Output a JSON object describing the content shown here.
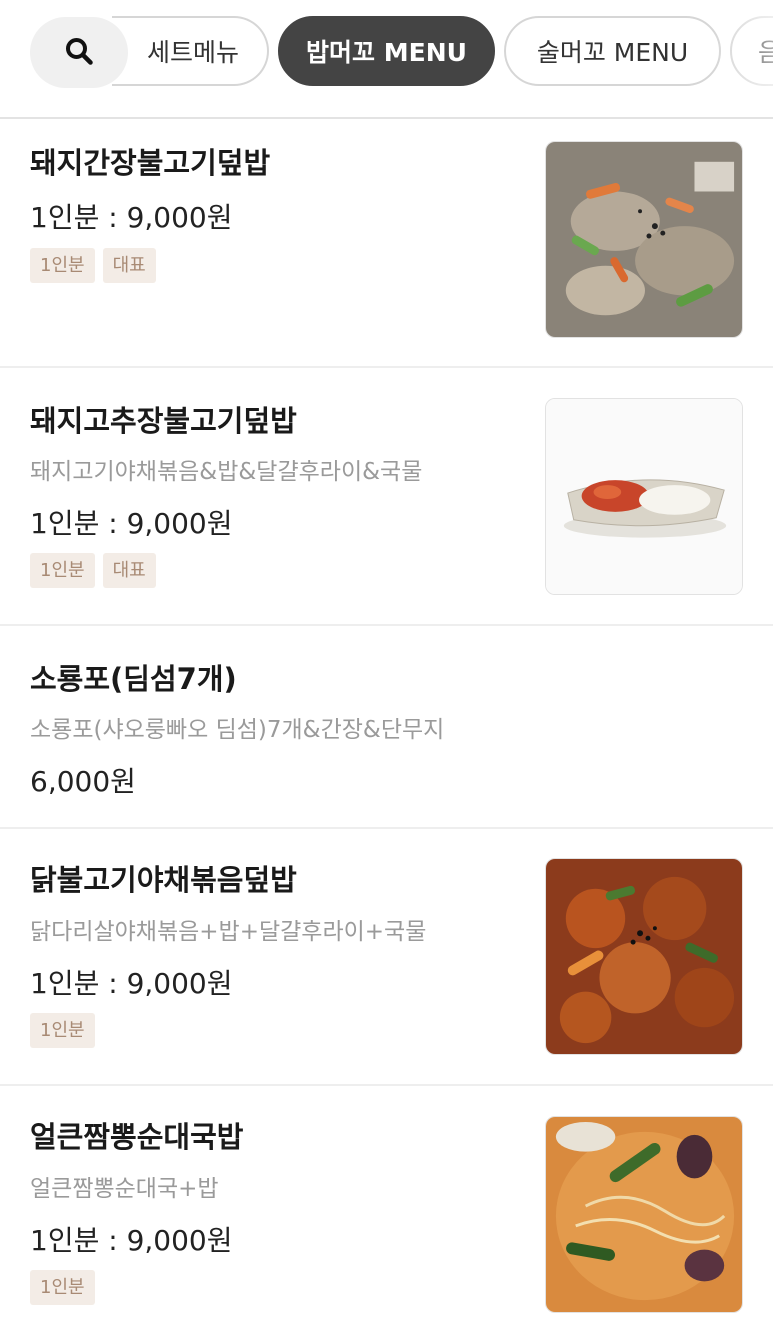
{
  "categories": [
    {
      "label": "세트메뉴",
      "active": false
    },
    {
      "label": "밥머꼬 MENU",
      "active": true
    },
    {
      "label": "술머꼬 MENU",
      "active": false
    },
    {
      "label": "음",
      "active": false
    }
  ],
  "icons": {
    "search": "search-icon"
  },
  "colors": {
    "active_tab": "#444444",
    "tag_bg": "#f3ece6",
    "tag_text": "#a88a74"
  },
  "menu": [
    {
      "name": "돼지간장불고기덮밥",
      "description": "",
      "price": "1인분 : 9,000원",
      "tags": [
        "1인분",
        "대표"
      ],
      "image": "soy-pork-bulgogi-photo"
    },
    {
      "name": "돼지고추장불고기덮밥",
      "description": "돼지고기야채볶음&밥&달걀후라이&국물",
      "price": "1인분 : 9,000원",
      "tags": [
        "1인분",
        "대표"
      ],
      "image": "spicy-pork-rice-photo"
    },
    {
      "name": "소룡포(딤섬7개)",
      "description": "소룡포(샤오룽빠오 딤섬)7개&간장&단무지",
      "price": "6,000원",
      "tags": [],
      "image": ""
    },
    {
      "name": "닭불고기야채볶음덮밥",
      "description": "닭다리살야채볶음+밥+달걀후라이+국물",
      "price": "1인분 : 9,000원",
      "tags": [
        "1인분"
      ],
      "image": "chicken-bulgogi-photo"
    },
    {
      "name": "얼큰짬뽕순대국밥",
      "description": "얼큰짬뽕순대국+밥",
      "price": "1인분 : 9,000원",
      "tags": [
        "1인분"
      ],
      "image": "jjamppong-sundae-soup-photo"
    }
  ]
}
